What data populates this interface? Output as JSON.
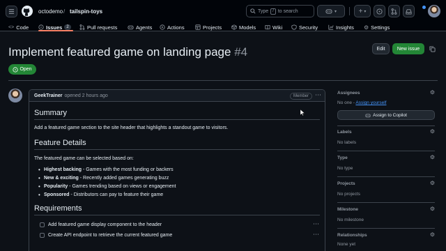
{
  "header": {
    "org": "octodemo",
    "separator": "/",
    "repo": "tailspin-toys",
    "search_placeholder": "Type / to search",
    "search_prefix": "Type",
    "search_key": "/",
    "search_suffix": "to search"
  },
  "tabs": [
    {
      "label": "Code",
      "icon": "code-icon"
    },
    {
      "label": "Issues",
      "icon": "issue-icon",
      "count": "2"
    },
    {
      "label": "Pull requests",
      "icon": "pull-request-icon"
    },
    {
      "label": "Agents",
      "icon": "agent-icon"
    },
    {
      "label": "Actions",
      "icon": "play-icon"
    },
    {
      "label": "Projects",
      "icon": "table-icon"
    },
    {
      "label": "Models",
      "icon": "cube-icon"
    },
    {
      "label": "Wiki",
      "icon": "book-icon"
    },
    {
      "label": "Security",
      "icon": "shield-icon"
    },
    {
      "label": "Insights",
      "icon": "graph-icon"
    },
    {
      "label": "Settings",
      "icon": "gear-icon"
    }
  ],
  "issue": {
    "title": "Implement featured game on landing page",
    "number": "#4",
    "state": "Open",
    "edit_label": "Edit",
    "new_issue_label": "New issue"
  },
  "comment": {
    "author": "GeekTrainer",
    "meta": "opened 2 hours ago",
    "role_badge": "Member",
    "summary_heading": "Summary",
    "summary_text": "Add a featured game section to the site header that highlights a standout game to visitors.",
    "details_heading": "Feature Details",
    "details_intro": "The featured game can be selected based on:",
    "criteria": [
      {
        "term": "Highest backing",
        "desc": " - Games with the most funding or backers"
      },
      {
        "term": "New & exciting",
        "desc": " - Recently added games generating buzz"
      },
      {
        "term": "Popularity",
        "desc": " - Games trending based on views or engagement"
      },
      {
        "term": "Sponsored",
        "desc": " - Distributors can pay to feature their game"
      }
    ],
    "requirements_heading": "Requirements",
    "tasks": [
      "Add featured game display component to the header",
      "Create API endpoint to retrieve the current featured game"
    ]
  },
  "sidebar": {
    "assignees": {
      "heading": "Assignees",
      "none_text": "No one -",
      "assign_link": "Assign yourself",
      "copilot_button": "Assign to Copilot"
    },
    "labels": {
      "heading": "Labels",
      "value": "No labels"
    },
    "type": {
      "heading": "Type",
      "value": "No type"
    },
    "projects": {
      "heading": "Projects",
      "value": "No projects"
    },
    "milestone": {
      "heading": "Milestone",
      "value": "No milestone"
    },
    "relationships": {
      "heading": "Relationships",
      "value": "None yet"
    }
  },
  "colors": {
    "background": "#0d1117",
    "open_green": "#238636",
    "accent_underline": "#f78166",
    "link_blue": "#4493f8"
  }
}
